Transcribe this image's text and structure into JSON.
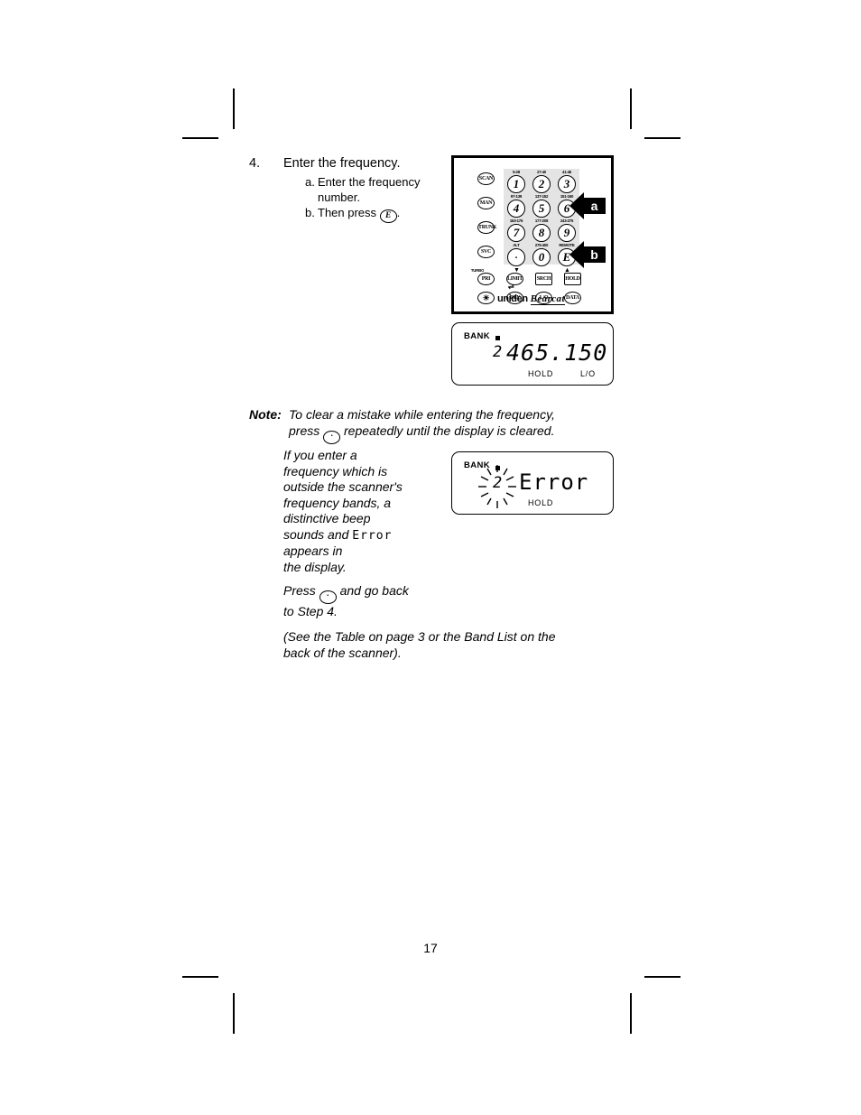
{
  "page": {
    "number": "17"
  },
  "step": {
    "number": "4.",
    "title": "Enter the frequency.",
    "substeps": [
      {
        "label": "a.",
        "text": "Enter the frequency number."
      },
      {
        "label": "b.",
        "text_before": "Then press ",
        "key": "E",
        "text_after": "."
      }
    ]
  },
  "keypad": {
    "callouts": [
      {
        "id": "a",
        "label": "a"
      },
      {
        "id": "b",
        "label": "b"
      }
    ],
    "function_column": [
      "SCAN",
      "MAN",
      "TRUNK",
      "SVC"
    ],
    "numeric_keys": [
      {
        "key": "1",
        "band": "5-28"
      },
      {
        "key": "2",
        "band": "27-40"
      },
      {
        "key": "3",
        "band": "41-46"
      },
      {
        "key": "4",
        "band": "97-139"
      },
      {
        "key": "5",
        "band": "137-152"
      },
      {
        "key": "6",
        "band": "151-160"
      },
      {
        "key": "7",
        "band": "163-176"
      },
      {
        "key": "8",
        "band": "177-208"
      },
      {
        "key": "9",
        "band": "243-275"
      },
      {
        "key": ".",
        "band": "ALT"
      },
      {
        "key": "0",
        "band": "275-400"
      },
      {
        "key": "E",
        "band": "REMOTE"
      }
    ],
    "row_priority": [
      "PRI",
      "LIMIT",
      "SRCH",
      "HOLD"
    ],
    "row_priority_sup": [
      "TURBO",
      "▼",
      "",
      "▲"
    ],
    "row_bottom": [
      "☀",
      "DLY",
      "L/O",
      "DATA"
    ],
    "logo_brand": "uniden",
    "logo_model": "Bearcat"
  },
  "display_frequency": {
    "bank_label": "BANK",
    "bank_number": "2",
    "frequency": "465.150",
    "hold_label": "HOLD",
    "lockout_label": "L/O"
  },
  "display_error": {
    "bank_label": "BANK",
    "bank_number": "2",
    "message": "Error",
    "hold_label": "HOLD"
  },
  "note": {
    "label": "Note:",
    "line1_before": "To clear a mistake while entering the frequency,",
    "line2_before": "press ",
    "line2_key": ".",
    "line2_after": " repeatedly until the display is cleared."
  },
  "paragraphs": {
    "error_explanation_1": "If you enter a",
    "error_explanation_2": "frequency which is",
    "error_explanation_3": "outside the scanner's",
    "error_explanation_4": "frequency bands, a",
    "error_explanation_5": "distinctive beep",
    "error_explanation_6_before": "sounds and ",
    "error_explanation_6_lcd": "Error",
    "error_explanation_7": "appears in",
    "error_explanation_8": "the display.",
    "press_line1_before": "Press ",
    "press_line1_key": ".",
    "press_line1_after": " and go back",
    "press_line2": "to Step 4.",
    "see_table_1": "(See the Table on page 3 or the Band List on the",
    "see_table_2": "back of the scanner)."
  }
}
